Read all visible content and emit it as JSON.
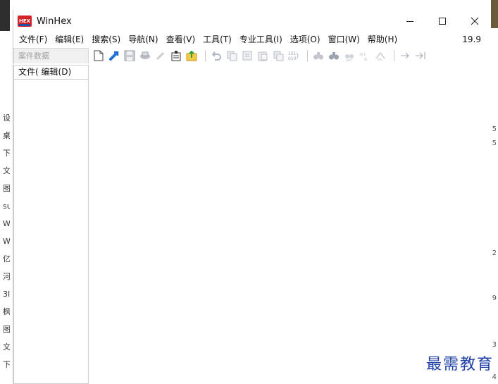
{
  "window": {
    "title": "WinHex",
    "version": "19.9"
  },
  "menu": [
    "文件(F)",
    "编辑(E)",
    "搜索(S)",
    "导航(N)",
    "查看(V)",
    "工具(T)",
    "专业工具(I)",
    "选项(O)",
    "窗口(W)",
    "帮助(H)"
  ],
  "side_tab": {
    "label": "案件数据"
  },
  "panel": {
    "menu_file": "文件(",
    "menu_edit": "编辑(D)"
  },
  "toolbar_icons": [
    "new-file-icon",
    "open-file-icon",
    "save-icon",
    "print-icon",
    "properties-icon",
    "export-icon",
    "undo-icon",
    "copy-icon",
    "cut-icon",
    "paste-icon",
    "paste-special-icon",
    "binary-icon",
    "find-icon",
    "find-hex-icon",
    "find-text-icon",
    "replace-icon",
    "replace-hex-icon",
    "arrow-right-icon",
    "arrow-right-end-icon"
  ],
  "background": {
    "left_chars": [
      "设",
      "桌",
      "下",
      "文",
      "图",
      "su",
      "W",
      "W",
      "亿",
      "河",
      "3I",
      "枫",
      "图",
      "文",
      "下"
    ],
    "right_nums": [
      "5",
      "5",
      "2",
      "9",
      "3",
      "4"
    ]
  },
  "watermark": "最需教育",
  "colors": {
    "accent": "#1f6fd6",
    "brand_red": "#d2232a",
    "watermark": "#1f3fa8"
  }
}
